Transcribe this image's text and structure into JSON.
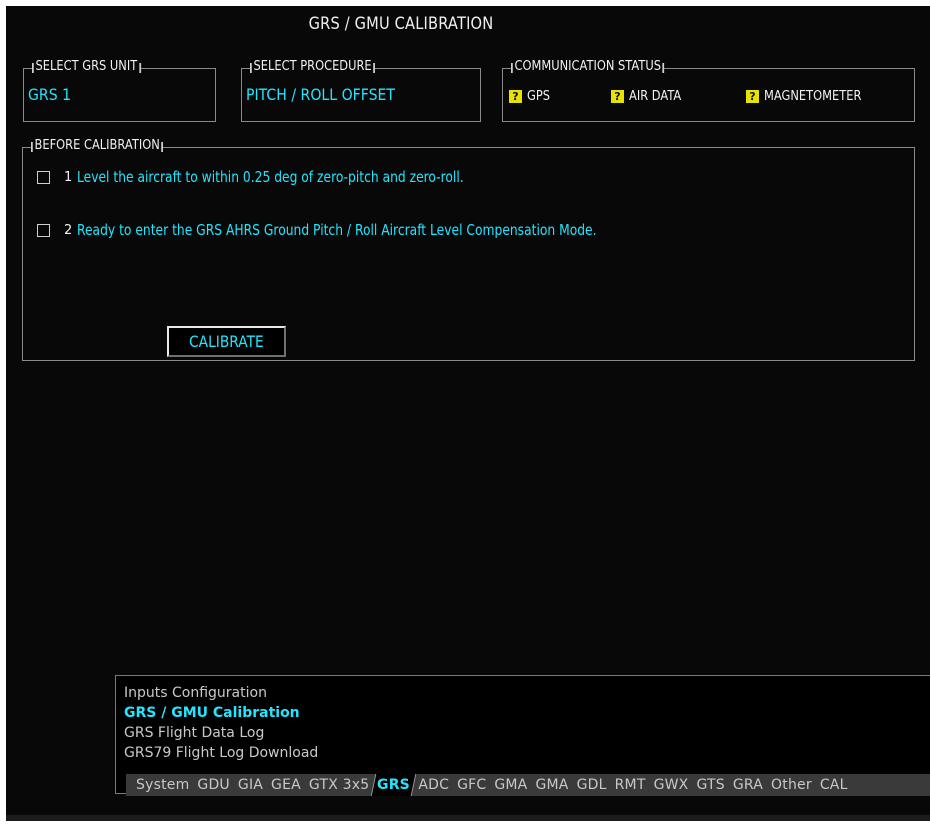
{
  "title": "GRS / GMU CALIBRATION",
  "select_unit": {
    "legend": "SELECT GRS UNIT",
    "value": "GRS 1"
  },
  "select_procedure": {
    "legend": "SELECT PROCEDURE",
    "value": "PITCH / ROLL OFFSET"
  },
  "comm_status": {
    "legend": "COMMUNICATION STATUS",
    "items": [
      {
        "icon": "question-icon",
        "glyph": "?",
        "label": "GPS"
      },
      {
        "icon": "question-icon",
        "glyph": "?",
        "label": "AIR DATA"
      },
      {
        "icon": "question-icon",
        "glyph": "?",
        "label": "MAGNETOMETER"
      }
    ]
  },
  "before_calibration": {
    "legend": "BEFORE CALIBRATION",
    "steps": [
      {
        "num": "1",
        "text": "Level the aircraft to within 0.25 deg of zero-pitch and zero-roll."
      },
      {
        "num": "2",
        "text": "Ready to enter the GRS AHRS Ground Pitch / Roll Aircraft Level Compensation Mode."
      }
    ],
    "calibrate_label": "CALIBRATE"
  },
  "menu": {
    "items": [
      {
        "label": "Inputs Configuration",
        "active": false
      },
      {
        "label": "GRS / GMU Calibration",
        "active": true
      },
      {
        "label": "GRS Flight Data Log",
        "active": false
      },
      {
        "label": "GRS79 Flight Log Download",
        "active": false
      }
    ],
    "tabs": [
      "System",
      "GDU",
      "GIA",
      "GEA",
      "GTX 3x5",
      "GRS",
      "ADC",
      "GFC",
      "GMA",
      "GMA",
      "GDL",
      "RMT",
      "GWX",
      "GTS",
      "GRA",
      "Other",
      "CAL"
    ],
    "active_tab": "GRS"
  },
  "colors": {
    "accent_cyan": "#22e5ff",
    "background": "#080808",
    "warning_yellow": "#e8e200"
  }
}
